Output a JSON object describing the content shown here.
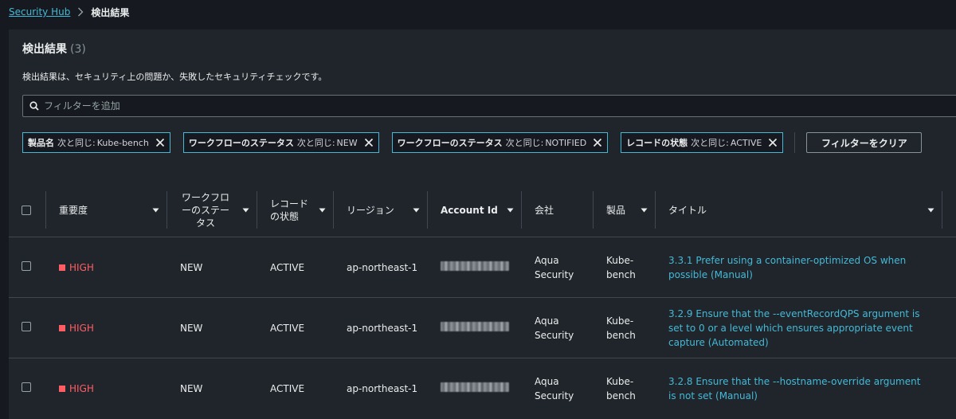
{
  "breadcrumb": {
    "root": "Security Hub",
    "current": "検出結果"
  },
  "panel": {
    "title": "検出結果",
    "count": "(3)",
    "description": "検出結果は、セキュリティ上の問題か、失敗したセキュリティチェックです。"
  },
  "filter": {
    "placeholder": "フィルターを追加"
  },
  "tokens": [
    {
      "key": "製品名",
      "op": "次と同じ:",
      "value": "Kube-bench"
    },
    {
      "key": "ワークフローのステータス",
      "op": "次と同じ:",
      "value": "NEW"
    },
    {
      "key": "ワークフローのステータス",
      "op": "次と同じ:",
      "value": "NOTIFIED"
    },
    {
      "key": "レコードの状態",
      "op": "次と同じ:",
      "value": "ACTIVE"
    }
  ],
  "clear_filters_label": "フィルターをクリア",
  "columns": {
    "severity": "重要度",
    "workflow": "ワークフローのステータス",
    "record": "レコードの状態",
    "region": "リージョン",
    "account": "Account Id",
    "company": "会社",
    "product": "製品",
    "title": "タイトル"
  },
  "rows": [
    {
      "severity": "HIGH",
      "workflow": "NEW",
      "record": "ACTIVE",
      "region": "ap-northeast-1",
      "company": "Aqua Security",
      "product": "Kube-bench",
      "title": "3.3.1 Prefer using a container-optimized OS when possible (Manual)"
    },
    {
      "severity": "HIGH",
      "workflow": "NEW",
      "record": "ACTIVE",
      "region": "ap-northeast-1",
      "company": "Aqua Security",
      "product": "Kube-bench",
      "title": "3.2.9 Ensure that the --eventRecordQPS argument is set to 0 or a level which ensures appropriate event capture (Automated)"
    },
    {
      "severity": "HIGH",
      "workflow": "NEW",
      "record": "ACTIVE",
      "region": "ap-northeast-1",
      "company": "Aqua Security",
      "product": "Kube-bench",
      "title": "3.2.8 Ensure that the --hostname-override argument is not set (Manual)"
    }
  ],
  "colors": {
    "accent": "#44b9d6",
    "severity_high": "#ff5d64",
    "background": "#16191f",
    "panel": "#20252c"
  },
  "icons": {
    "search": "search-icon",
    "close": "close-icon",
    "sort": "caret-down-icon",
    "separator": "chevron-right-icon"
  }
}
